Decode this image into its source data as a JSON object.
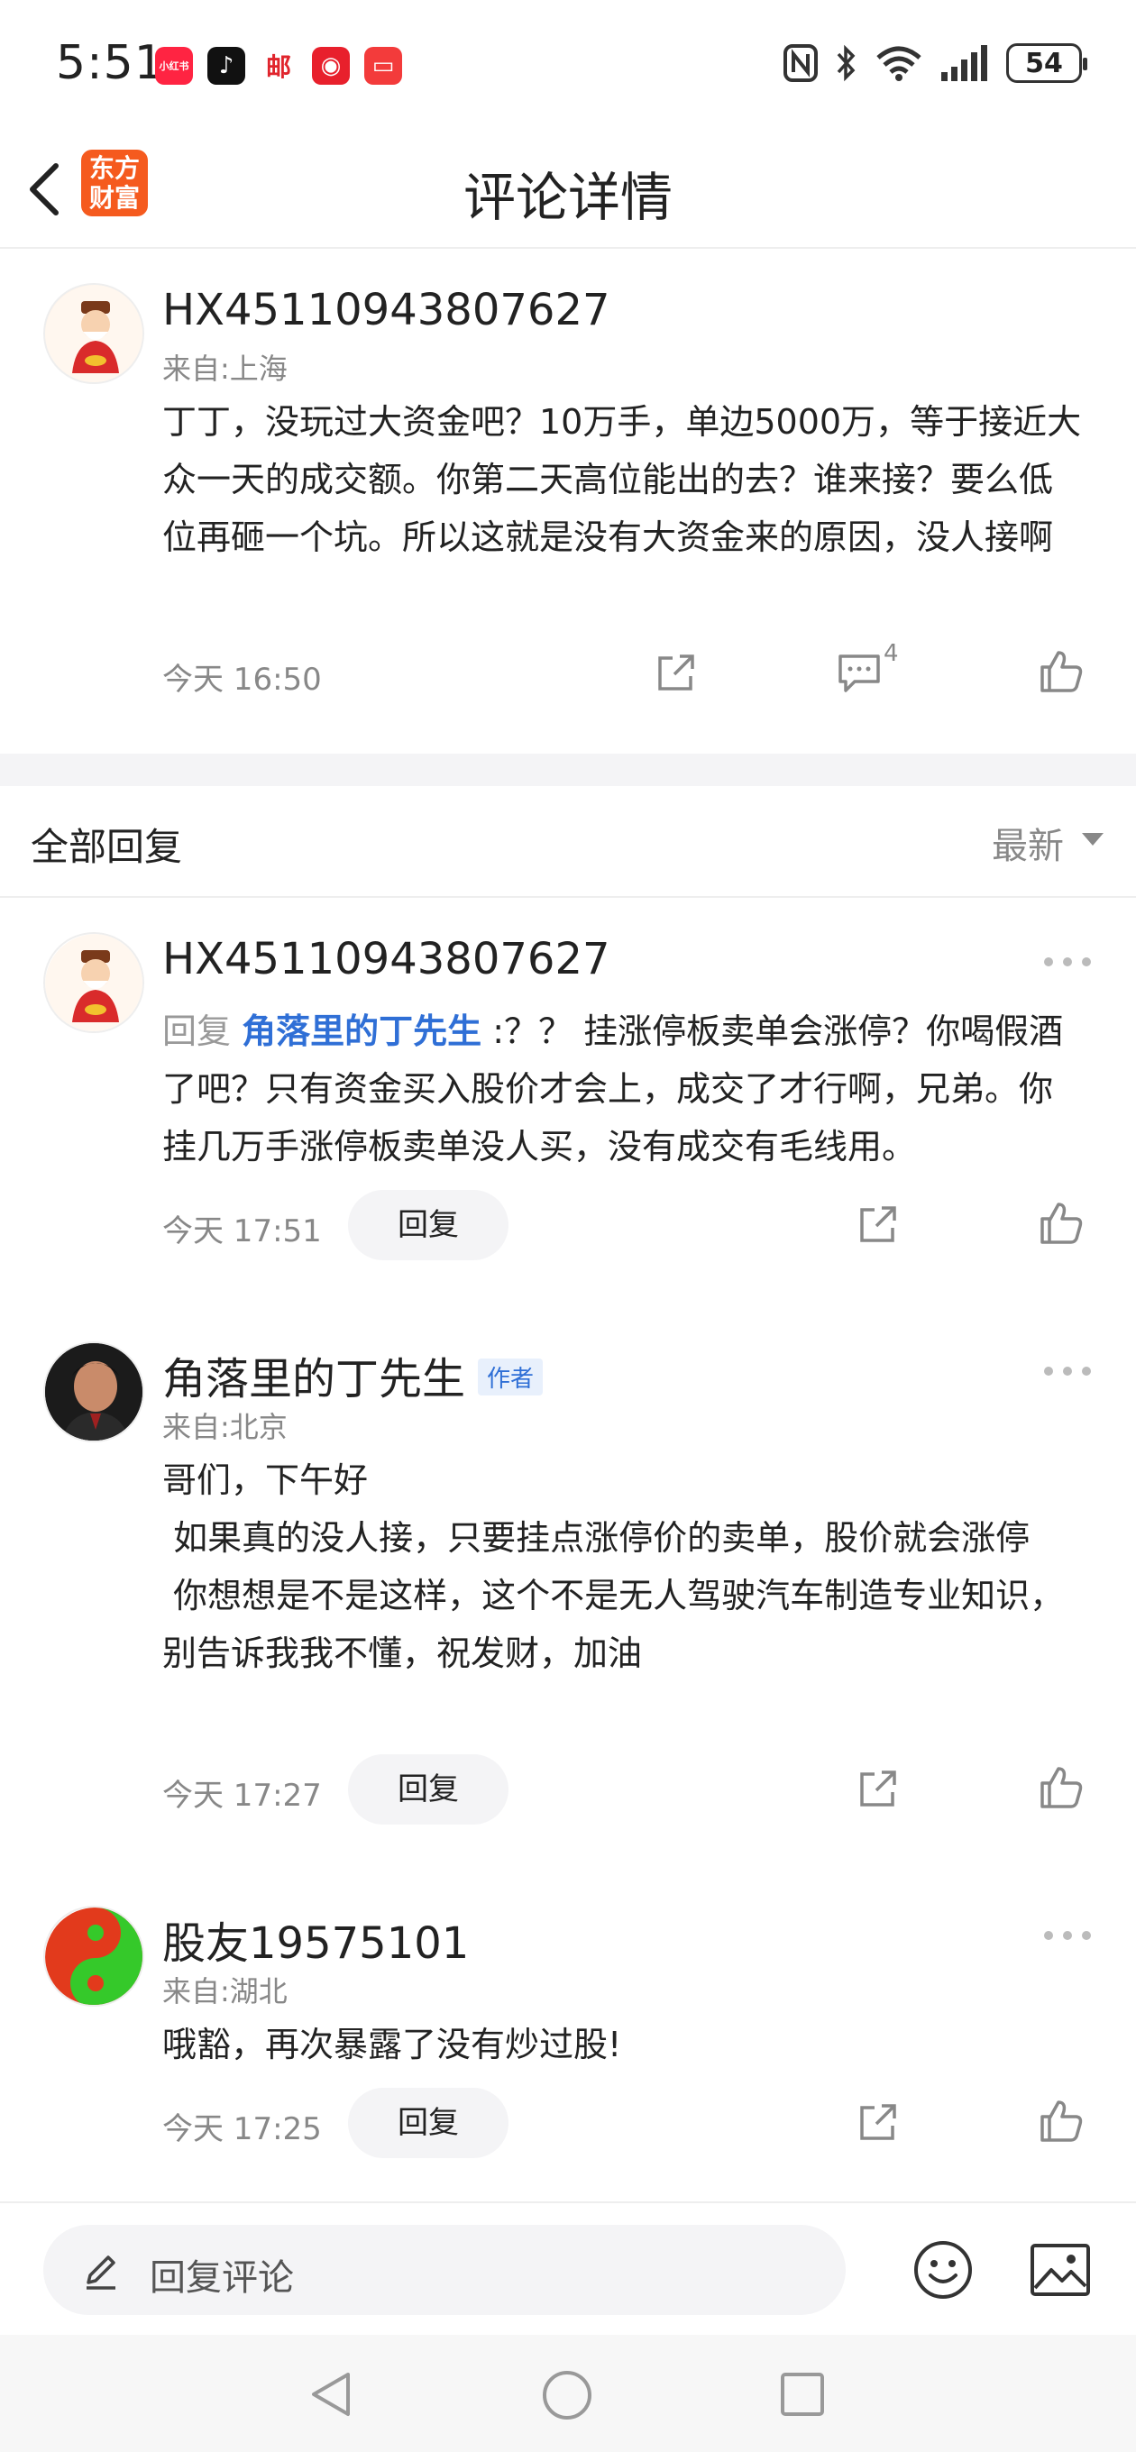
{
  "status_bar": {
    "time": "5:51",
    "battery": "54",
    "app_icons": [
      {
        "name": "xiaohongshu-icon",
        "label": "小红书",
        "color": "#ff2442"
      },
      {
        "name": "douyin-icon",
        "label": "♪",
        "color": "#111111"
      },
      {
        "name": "mail-icon",
        "label": "邮",
        "color": "#ffffff"
      },
      {
        "name": "netease-music-icon",
        "label": "◉",
        "color": "#e8202c"
      },
      {
        "name": "red-app-icon",
        "label": "▭",
        "color": "#f33b3b"
      }
    ]
  },
  "header": {
    "title": "评论详情",
    "brand_line1": "东方",
    "brand_line2": "财富",
    "brand_color": "#f55a1e"
  },
  "main_comment": {
    "username": "HX45110943807627",
    "location": "来自:上海",
    "text": "丁丁，没玩过大资金吧？10万手，单边5000万，等于接近大众一天的成交额。你第二天高位能出的去？谁来接？要么低位再砸一个坑。所以这就是没有大资金来的原因，没人接啊",
    "time": "今天 16:50",
    "comment_count": "4"
  },
  "section": {
    "title": "全部回复",
    "sort": "最新"
  },
  "replies": [
    {
      "username": "HX45110943807627",
      "reply_prefix": "回复",
      "reply_to": "角落里的丁先生",
      "text": ":？？ 挂涨停板卖单会涨停？你喝假酒了吧？只有资金买入股价才会上，成交了才行啊，兄弟。你挂几万手涨停板卖单没人买，没有成交有毛线用。",
      "time": "今天 17:51",
      "reply_label": "回复"
    },
    {
      "username": "角落里的丁先生",
      "badge": "作者",
      "location": "来自:北京",
      "line1": "哥们，下午好",
      "line2": " 如果真的没人接，只要挂点涨停价的卖单，股价就会涨停",
      "line3": " 你想想是不是这样，这个不是无人驾驶汽车制造专业知识，别告诉我我不懂，祝发财，加油",
      "time": "今天 17:27",
      "reply_label": "回复"
    },
    {
      "username": "股友19575101",
      "location": "来自:湖北",
      "text": "哦豁，再次暴露了没有炒过股!",
      "time": "今天 17:25",
      "reply_label": "回复"
    }
  ],
  "bottom_bar": {
    "placeholder": "回复评论"
  }
}
